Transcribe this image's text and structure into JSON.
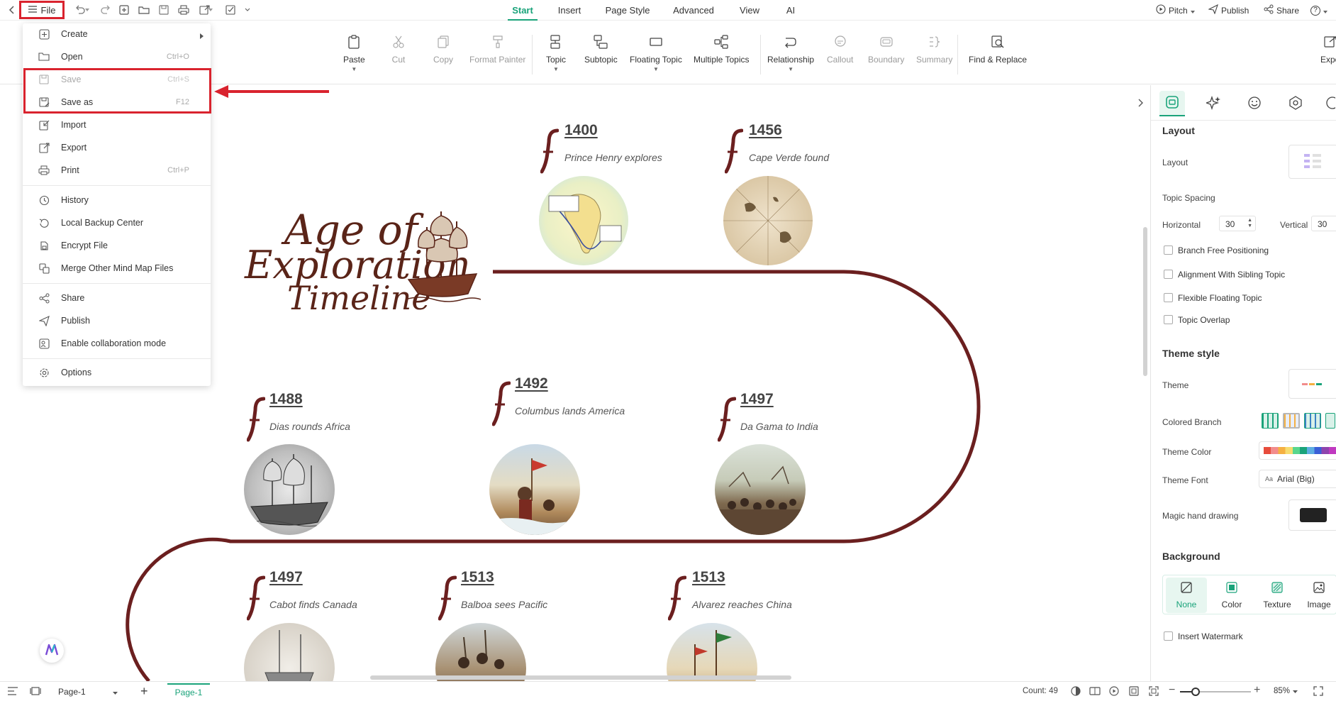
{
  "topbar": {
    "file_label": "File",
    "tabs": [
      {
        "label": "Start",
        "active": true
      },
      {
        "label": "Insert"
      },
      {
        "label": "Page Style"
      },
      {
        "label": "Advanced"
      },
      {
        "label": "View"
      },
      {
        "label": "AI"
      }
    ],
    "right": {
      "pitch": "Pitch",
      "publish": "Publish",
      "share": "Share",
      "help": "?"
    }
  },
  "ribbon": {
    "paste": "Paste",
    "cut": "Cut",
    "copy": "Copy",
    "format_painter": "Format Painter",
    "topic": "Topic",
    "subtopic": "Subtopic",
    "floating_topic": "Floating Topic",
    "multiple_topics": "Multiple Topics",
    "relationship": "Relationship",
    "callout": "Callout",
    "boundary": "Boundary",
    "summary": "Summary",
    "find_replace": "Find & Replace",
    "exp": "Expo"
  },
  "file_menu": {
    "items": [
      {
        "label": "Create",
        "shortcut": "",
        "submenu": true
      },
      {
        "label": "Open",
        "shortcut": "Ctrl+O"
      },
      {
        "label": "Save",
        "shortcut": "Ctrl+S",
        "disabled": true
      },
      {
        "label": "Save as",
        "shortcut": "F12"
      },
      {
        "label": "Import",
        "shortcut": ""
      },
      {
        "label": "Export",
        "shortcut": ""
      },
      {
        "label": "Print",
        "shortcut": "Ctrl+P"
      },
      {
        "label": "History",
        "shortcut": ""
      },
      {
        "label": "Local Backup Center",
        "shortcut": ""
      },
      {
        "label": "Encrypt File",
        "shortcut": ""
      },
      {
        "label": "Merge Other Mind Map Files",
        "shortcut": ""
      },
      {
        "label": "Share",
        "shortcut": ""
      },
      {
        "label": "Publish",
        "shortcut": ""
      },
      {
        "label": "Enable collaboration mode",
        "shortcut": ""
      },
      {
        "label": "Options",
        "shortcut": ""
      }
    ],
    "highlight_color": "#d9232e"
  },
  "timeline": {
    "title_line1": "Age of",
    "title_line2": "Exploration",
    "title_line3": "Timeline",
    "events": [
      {
        "year": "1400",
        "desc": "Prince Henry explores"
      },
      {
        "year": "1456",
        "desc": "Cape Verde found"
      },
      {
        "year": "1488",
        "desc": "Dias rounds Africa"
      },
      {
        "year": "1492",
        "desc": "Columbus lands America"
      },
      {
        "year": "1497",
        "desc": "Da Gama to India"
      },
      {
        "year": "1497",
        "desc": "Cabot finds Canada"
      },
      {
        "year": "1513",
        "desc": "Balboa sees Pacific"
      },
      {
        "year": "1513",
        "desc": "Alvarez reaches China"
      }
    ],
    "line_color": "#6b1f1f"
  },
  "right_panel": {
    "layout_head": "Layout",
    "layout_label": "Layout",
    "topic_spacing": "Topic Spacing",
    "horizontal_label": "Horizontal",
    "horizontal_value": "30",
    "vertical_label": "Vertical",
    "vertical_value": "30",
    "checks": [
      "Branch Free Positioning",
      "Alignment With Sibling Topic",
      "Flexible Floating Topic",
      "Topic Overlap"
    ],
    "theme_style_head": "Theme style",
    "theme_label": "Theme",
    "colored_branch": "Colored Branch",
    "theme_color": "Theme Color",
    "theme_font": "Theme Font",
    "theme_font_value": "Arial (Big)",
    "theme_font_prefix": "Aa",
    "magic_hand": "Magic hand drawing",
    "background_head": "Background",
    "bg_options": [
      "None",
      "Color",
      "Texture",
      "Image"
    ],
    "insert_watermark": "Insert Watermark",
    "accent": "#1aa37a"
  },
  "statusbar": {
    "page_select": "Page-1",
    "page_tab": "Page-1",
    "count": "Count: 49",
    "zoom": "85%"
  }
}
